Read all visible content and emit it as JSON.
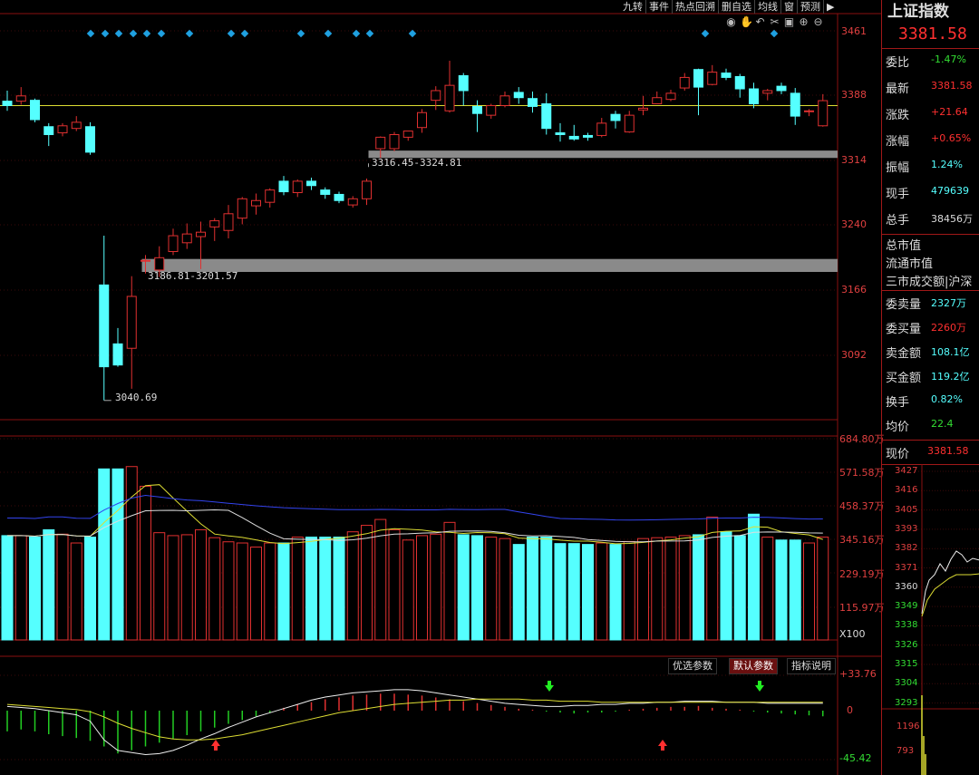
{
  "toolbar": [
    "九转",
    "事件",
    "热点回溯",
    "删自选",
    "均线",
    "窗",
    "预测"
  ],
  "tool_icons": [
    "eye-icon",
    "hand-icon",
    "undo-icon",
    "scissors-icon",
    "save-icon",
    "zoom-in-icon",
    "zoom-out-icon"
  ],
  "price_axis": [
    "3461",
    "3388",
    "3314",
    "3240",
    "3166",
    "3092"
  ],
  "volume_axis": [
    "684.80万",
    "571.58万",
    "458.37万",
    "345.16万",
    "229.19万",
    "115.97万"
  ],
  "volume_unit": "X100",
  "macd_axis": {
    "top": "+33.76",
    "zero": "0",
    "bottom": "-45.42"
  },
  "annotations": {
    "gap_upper": "3316.45-3324.81",
    "gap_lower": "3186.81-3201.57",
    "low": "3040.69"
  },
  "param_buttons": [
    "优选参数",
    "默认参数",
    "指标说明"
  ],
  "colors": {
    "up": "#e03030",
    "down": "#55ffff",
    "ref_line": "#dddd33",
    "gap": "#8a8a8a"
  },
  "right_panel": {
    "title": "上证指数",
    "price": "3381.58",
    "rows": [
      {
        "k": "委比",
        "v": "-1.47%",
        "c": "#33dd33"
      },
      {
        "k": "最新",
        "v": "3381.58",
        "c": "#ff3030"
      },
      {
        "k": "涨跌",
        "v": "+21.64",
        "c": "#ff3030"
      },
      {
        "k": "涨幅",
        "v": "+0.65%",
        "c": "#ff3030"
      },
      {
        "k": "振幅",
        "v": "1.24%",
        "c": "#55ffff"
      },
      {
        "k": "现手",
        "v": "479639",
        "c": "#55ffff"
      },
      {
        "k": "总手",
        "v": "38456万",
        "c": "#dddddd"
      }
    ],
    "market_rows": [
      "总市值",
      "流通市值",
      "三市成交额|沪深"
    ],
    "rows2": [
      {
        "k": "委卖量",
        "v": "2327万",
        "c": "#55ffff"
      },
      {
        "k": "委买量",
        "v": "2260万",
        "c": "#ff3030"
      },
      {
        "k": "卖金额",
        "v": "108.1亿",
        "c": "#55ffff"
      },
      {
        "k": "买金额",
        "v": "119.2亿",
        "c": "#55ffff"
      },
      {
        "k": "换手",
        "v": "0.82%",
        "c": "#55ffff"
      },
      {
        "k": "均价",
        "v": "22.4",
        "c": "#33dd33"
      }
    ],
    "cur_label": "现价",
    "cur_value": "3381.58",
    "mini_axis": [
      "3427",
      "3416",
      "3405",
      "3393",
      "3382",
      "3371",
      "3360",
      "3349",
      "3338",
      "3326",
      "3315",
      "3304",
      "3293"
    ],
    "mini_vol_axis": [
      "1196",
      "793"
    ]
  },
  "chart_data": {
    "type": "candlestick",
    "price_range": [
      3040.69,
      3461
    ],
    "candles": [
      [
        3381,
        3376,
        3393,
        3370
      ],
      [
        3381,
        3387,
        3397,
        3377
      ],
      [
        3382,
        3360,
        3384,
        3357
      ],
      [
        3352,
        3343,
        3356,
        3330
      ],
      [
        3345,
        3353,
        3356,
        3341
      ],
      [
        3350,
        3357,
        3364,
        3347
      ],
      [
        3352,
        3323,
        3357,
        3320
      ],
      [
        3172,
        3079,
        3228,
        3040.69
      ],
      [
        3105,
        3081,
        3123,
        3079
      ],
      [
        3100,
        3159,
        3182,
        3054
      ],
      [
        3200,
        3200,
        3206,
        3185
      ],
      [
        3189,
        3203,
        3216,
        3181
      ],
      [
        3210,
        3228,
        3236,
        3206
      ],
      [
        3220,
        3230,
        3242,
        3213
      ],
      [
        3227,
        3232,
        3244,
        3190
      ],
      [
        3238,
        3245,
        3248,
        3222
      ],
      [
        3234,
        3253,
        3263,
        3225
      ],
      [
        3248,
        3270,
        3272,
        3241
      ],
      [
        3262,
        3268,
        3276,
        3252
      ],
      [
        3266,
        3280,
        3282,
        3260
      ],
      [
        3290,
        3278,
        3296,
        3274
      ],
      [
        3277,
        3290,
        3292,
        3272
      ],
      [
        3290,
        3285,
        3294,
        3280
      ],
      [
        3280,
        3275,
        3283,
        3270
      ],
      [
        3275,
        3268,
        3278,
        3265
      ],
      [
        3263,
        3270,
        3273,
        3260
      ],
      [
        3270,
        3290,
        3293,
        3263
      ],
      [
        3327,
        3340,
        3341,
        3316.45
      ],
      [
        3327,
        3343,
        3346,
        3324
      ],
      [
        3340,
        3347,
        3347,
        3336
      ],
      [
        3351,
        3368,
        3372,
        3345
      ],
      [
        3382,
        3393,
        3398,
        3371
      ],
      [
        3370,
        3399,
        3427,
        3368
      ],
      [
        3410,
        3393,
        3413,
        3376
      ],
      [
        3375,
        3367,
        3382,
        3346
      ],
      [
        3365,
        3376,
        3378,
        3361
      ],
      [
        3376,
        3387,
        3392,
        3374
      ],
      [
        3391,
        3385,
        3397,
        3378
      ],
      [
        3384,
        3375,
        3392,
        3368
      ],
      [
        3378,
        3350,
        3390,
        3343
      ],
      [
        3345,
        3343,
        3356,
        3335
      ],
      [
        3341,
        3338,
        3354,
        3336
      ],
      [
        3342,
        3340,
        3345,
        3336
      ],
      [
        3342,
        3356,
        3362,
        3340
      ],
      [
        3366,
        3359,
        3370,
        3350
      ],
      [
        3346,
        3365,
        3370,
        3345
      ],
      [
        3371,
        3373,
        3387,
        3365
      ],
      [
        3378,
        3385,
        3392,
        3378
      ],
      [
        3383,
        3390,
        3394,
        3381
      ],
      [
        3396,
        3408,
        3413,
        3393
      ],
      [
        3417,
        3397,
        3418,
        3365
      ],
      [
        3400,
        3414,
        3422,
        3399
      ],
      [
        3413,
        3408,
        3418,
        3405
      ],
      [
        3409,
        3395,
        3412,
        3385
      ],
      [
        3395,
        3378,
        3402,
        3373
      ],
      [
        3390,
        3393,
        3395,
        3382
      ],
      [
        3398,
        3393,
        3402,
        3389
      ],
      [
        3390,
        3364,
        3396,
        3354
      ],
      [
        3370,
        3370,
        3372,
        3364
      ],
      [
        3353,
        3381.58,
        3389,
        3352
      ]
    ],
    "volumes": [
      355,
      355,
      350,
      375,
      360,
      330,
      350,
      582,
      582,
      590,
      523,
      365,
      355,
      358,
      375,
      348,
      334,
      330,
      316,
      330,
      330,
      350,
      350,
      350,
      350,
      368,
      390,
      410,
      375,
      340,
      355,
      360,
      400,
      358,
      355,
      350,
      345,
      325,
      350,
      350,
      328,
      328,
      325,
      330,
      325,
      335,
      345,
      348,
      350,
      355,
      358,
      418,
      368,
      355,
      428,
      350,
      340,
      340,
      330,
      350
    ],
    "macd_hist": [
      -22,
      -20,
      -22,
      -25,
      -27,
      -29,
      -32,
      -38,
      -45.42,
      -42,
      -38,
      -34,
      -30,
      -26,
      -22,
      -18,
      -14,
      -10,
      -6,
      -2,
      3,
      7,
      9,
      12,
      14,
      16,
      17,
      18,
      18,
      17,
      16,
      14,
      12,
      10,
      8,
      6,
      4,
      2,
      1,
      -1,
      -2,
      -3,
      -2,
      -2,
      -1,
      1,
      2,
      3,
      4,
      4,
      5,
      3,
      2,
      1,
      -1,
      -2,
      -3,
      -4,
      -5,
      -6
    ],
    "macd_dif": [
      4,
      3,
      2,
      0,
      -2,
      -4,
      -10,
      -28,
      -38,
      -40,
      -42,
      -41,
      -38,
      -33,
      -27,
      -22,
      -16,
      -11,
      -6,
      -2,
      2,
      6,
      10,
      13,
      15,
      17,
      18,
      19,
      20,
      20,
      19,
      17,
      15,
      13,
      11,
      9,
      7,
      6,
      5,
      4,
      4,
      5,
      5,
      6,
      6,
      7,
      7,
      8,
      8,
      9,
      9,
      9,
      8,
      8,
      8,
      7,
      7,
      7,
      7,
      7
    ],
    "macd_dea": [
      6,
      5,
      4,
      3,
      2,
      1,
      -1,
      -6,
      -12,
      -17,
      -21,
      -25,
      -27,
      -28,
      -28,
      -27,
      -25,
      -23,
      -20,
      -17,
      -14,
      -11,
      -8,
      -5,
      -2,
      0,
      2,
      4,
      6,
      7,
      8,
      9,
      10,
      10,
      11,
      11,
      11,
      11,
      10,
      10,
      9,
      9,
      9,
      8,
      8,
      8,
      8,
      8,
      8,
      8,
      8,
      8,
      8,
      8,
      8,
      8,
      8,
      8,
      8,
      8
    ]
  }
}
